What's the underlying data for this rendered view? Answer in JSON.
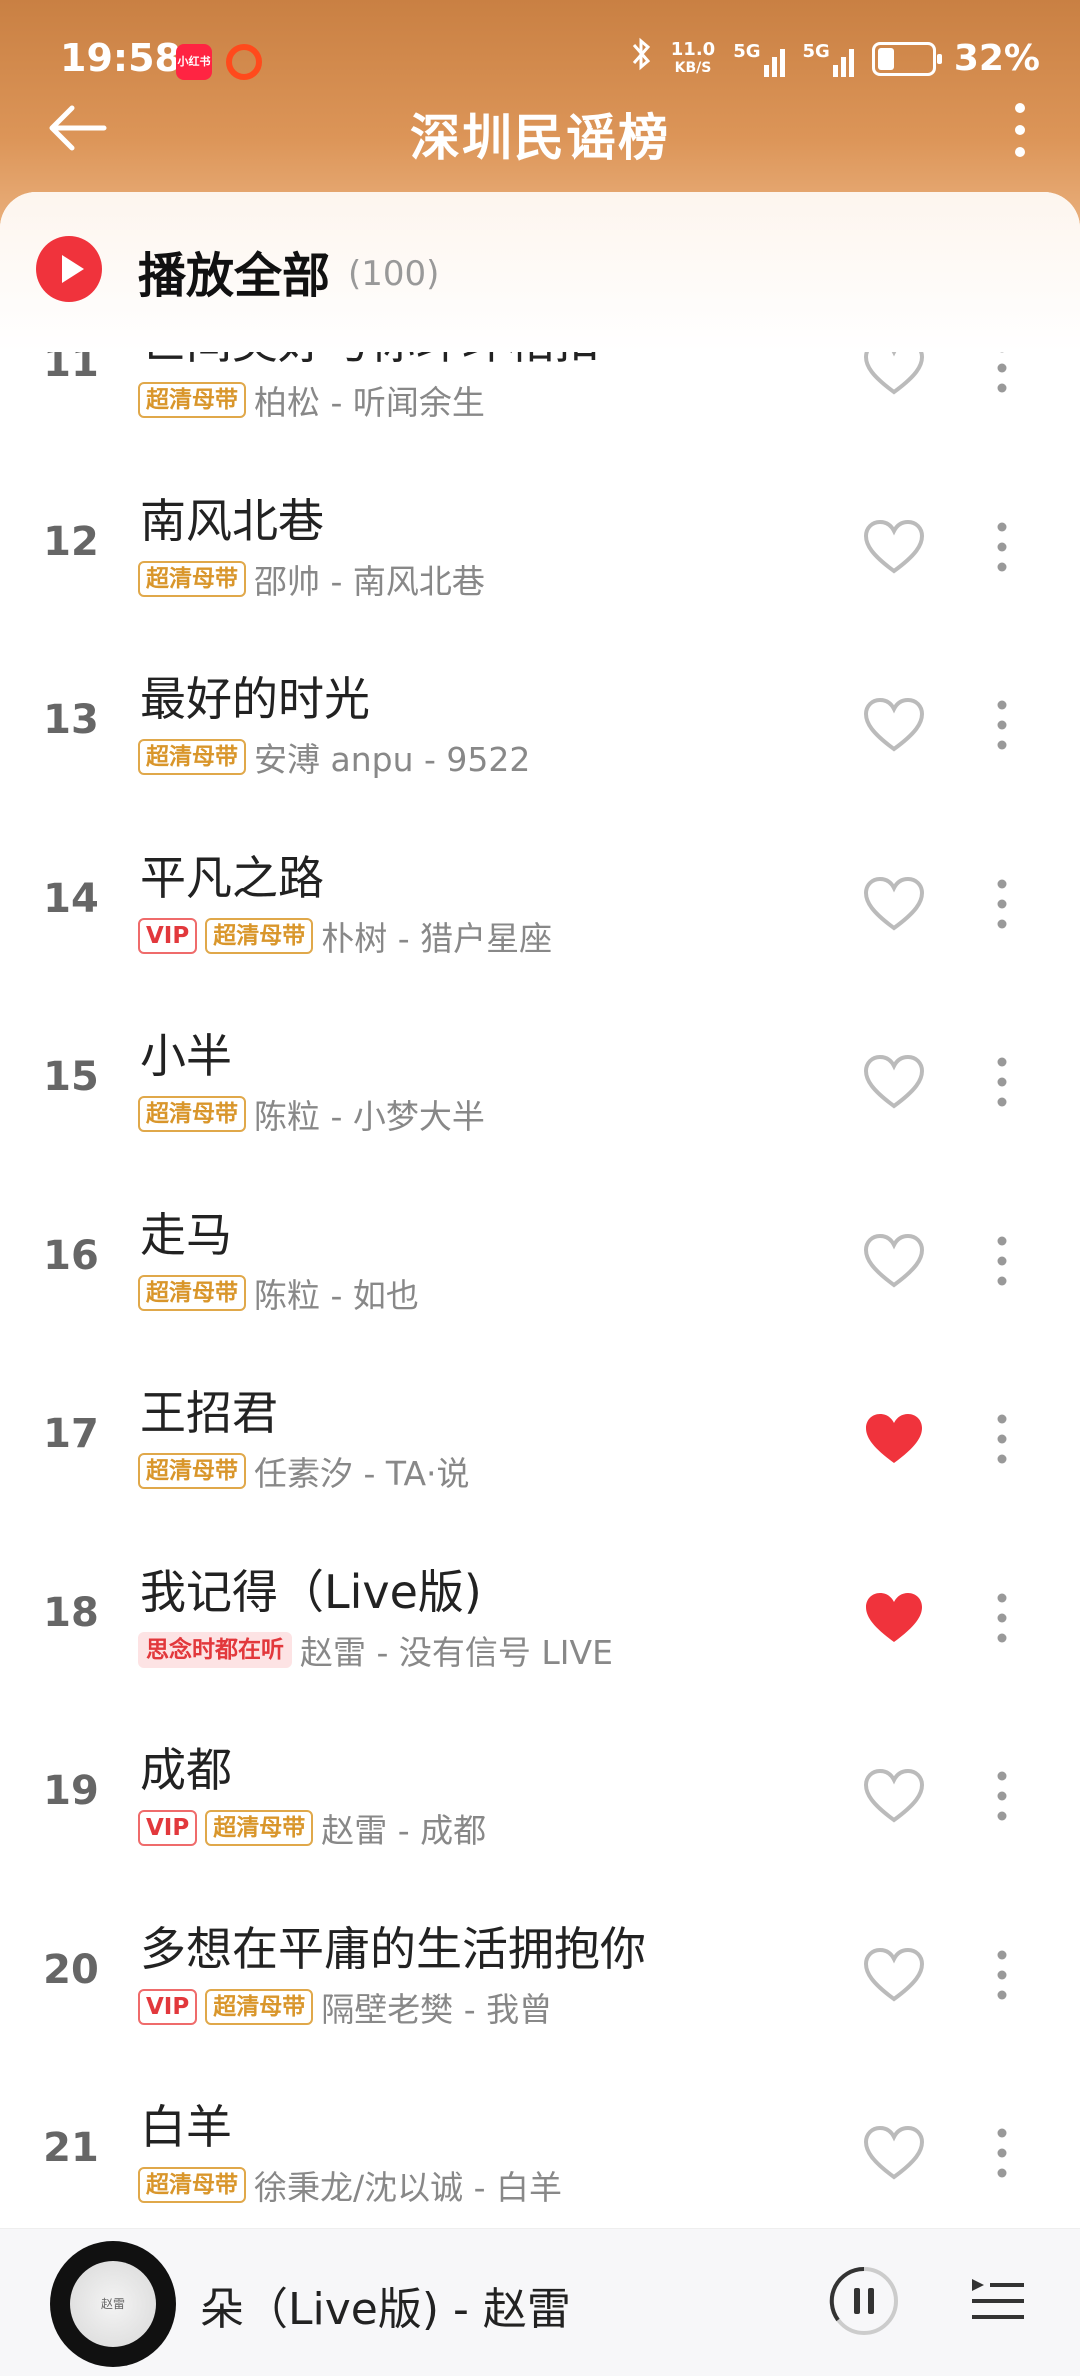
{
  "status_bar": {
    "time": "19:58",
    "app_badge": "小红书",
    "net_speed_value": "11.0",
    "net_speed_unit": "KB/S",
    "sim1": "5G",
    "sim2": "5G",
    "battery_percent": "32%",
    "battery_level": 0.32
  },
  "nav": {
    "title": "深圳民谣榜"
  },
  "play_all": {
    "label": "播放全部",
    "count": "(100)"
  },
  "songs": [
    {
      "rank": "11",
      "title": "世间美好与你环环相扣",
      "tags": [
        "超清母带"
      ],
      "artist_album": "柏松 - 听闻余生",
      "liked": false
    },
    {
      "rank": "12",
      "title": "南风北巷",
      "tags": [
        "超清母带"
      ],
      "artist_album": "邵帅 - 南风北巷",
      "liked": false
    },
    {
      "rank": "13",
      "title": "最好的时光",
      "tags": [
        "超清母带"
      ],
      "artist_album": "安溥 anpu - 9522",
      "liked": false
    },
    {
      "rank": "14",
      "title": "平凡之路",
      "tags": [
        "VIP",
        "超清母带"
      ],
      "artist_album": "朴树 - 猎户星座",
      "liked": false
    },
    {
      "rank": "15",
      "title": "小半",
      "tags": [
        "超清母带"
      ],
      "artist_album": "陈粒 - 小梦大半",
      "liked": false
    },
    {
      "rank": "16",
      "title": "走马",
      "tags": [
        "超清母带"
      ],
      "artist_album": "陈粒 - 如也",
      "liked": false
    },
    {
      "rank": "17",
      "title": "王招君",
      "tags": [
        "超清母带"
      ],
      "artist_album": "任素汐 - TA·说",
      "liked": true
    },
    {
      "rank": "18",
      "title": "我记得（Live版)",
      "tags": [
        "思念时都在听"
      ],
      "artist_album": "赵雷 - 没有信号 LIVE",
      "liked": true
    },
    {
      "rank": "19",
      "title": "成都",
      "tags": [
        "VIP",
        "超清母带"
      ],
      "artist_album": "赵雷 - 成都",
      "liked": false
    },
    {
      "rank": "20",
      "title": "多想在平庸的生活拥抱你",
      "tags": [
        "VIP",
        "超清母带"
      ],
      "artist_album": "隔壁老樊 - 我曾",
      "liked": false
    },
    {
      "rank": "21",
      "title": "白羊",
      "tags": [
        "超清母带"
      ],
      "artist_album": "徐秉龙/沈以诚 - 白羊",
      "liked": false
    }
  ],
  "player": {
    "now_playing": "朵（Live版) - 赵雷",
    "cover_text": "赵雷"
  },
  "colors": {
    "accent_red": "#f0333c",
    "header_orange": "#dc9558",
    "tag_gold": "#d9962b",
    "vip_red": "#e2383c"
  },
  "icons": [
    "back-arrow-icon",
    "more-vertical-icon",
    "play-circle-icon",
    "heart-outline-icon",
    "heart-filled-icon",
    "pause-icon",
    "playlist-icon"
  ]
}
